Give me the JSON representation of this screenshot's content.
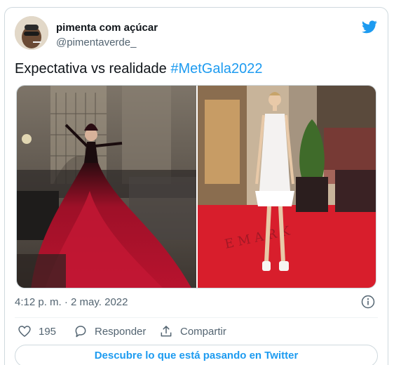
{
  "author": {
    "display_name": "pimenta com açúcar",
    "handle": "@pimentaverde_"
  },
  "tweet": {
    "text_prefix": "Expectativa vs realidade ",
    "hashtag": "#MetGala2022",
    "timestamp": "4:12 p. m. · 2 may. 2022"
  },
  "media": {
    "left_image": "gala-red-feather-gown-photo",
    "right_image": "white-feather-dress-red-carpet-photo"
  },
  "actions": {
    "likes_count": "195",
    "reply_label": "Responder",
    "share_label": "Compartir"
  },
  "cta": {
    "label": "Descubre lo que está pasando en Twitter"
  },
  "colors": {
    "accent": "#1d9bf0",
    "text": "#0f1419",
    "secondary": "#536471",
    "border": "#cfd9de"
  },
  "icons": {
    "brand": "twitter-bird-icon",
    "info": "info-icon",
    "like": "heart-icon",
    "reply": "reply-bubble-icon",
    "share": "share-upload-icon"
  }
}
